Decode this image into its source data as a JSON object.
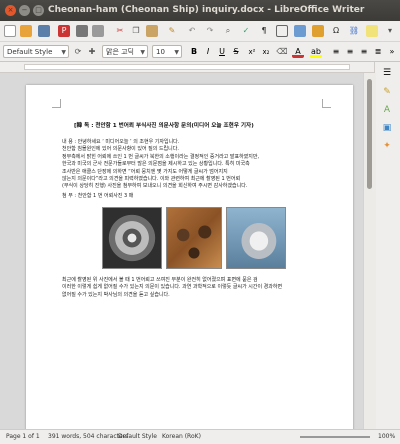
{
  "window": {
    "title": "Cheonan-ham (Cheonan Ship) inquiry.docx - LibreOffice Writer",
    "controls": {
      "close": "×",
      "minimize": "−",
      "maximize": "□"
    }
  },
  "toolbar": {
    "paragraph_style": "Default Style",
    "font_name": "맑은 고딕",
    "font_size": "10"
  },
  "document": {
    "heading": "[韓 독 : 천안함 1 번어뢰 부식사진 의문사항 문의(미디어 오늘 조현우 기자)",
    "body_lines": [
      "내 용 : 안녕하세요 ‘ 미디어오늘 ’ 의 조현우 기자입니다.",
      "천안함 침몰원인에 있어 의문사항이 있어 질의 드립니다.",
      "정부측에서 밝힌 어뢰에 쓰인 1 번 글씨가 북한의 소행이라는 결정적인 증거라고 발표하였지만,",
      "한국과 미국의 군사 전문가들로부터 많은 의문점을 제시하고 있는 상황입니다. 특히 미국측",
      "조사반은 애클스 단장에 의하면 “어뢰 뭉치엔 몇 가지도 어떻게 글씨가 엄어지지",
      "않는지 의문이다”라고 의견을 피력하였습니다. 이와 관련하여 최근에 촬영된 1 번어뢰",
      "(무식이 상당히 진행) 사진을 첨부하여 보내오니 의견을 회신하여 주시면 감사하겠습니다."
    ],
    "attachment_line": "첨 부 : 천안함 1 번 어뢰사진 3 매",
    "footer_lines": [
      "최근에 촬영된 위 사진에서 볼 때 1 번어뢰고 쓰여진 부분이 완전히 없어졌으며 표면에 묻은 검",
      "이러한 이렇게 쉽게 없어질 수가 있는지 의문이 있습니다. 과연 과학적으로 이렇듯 글씨가 시간이 경과하면",
      "없어질 수가 있는지 박사님의 의견을 듣고 싶습니다."
    ],
    "photos": [
      "torpedo-propeller-photo",
      "torpedo-rusted-gear-photo",
      "torpedo-motor-photo"
    ]
  },
  "status_bar": {
    "page": "Page 1 of 1",
    "word_count": "391 words, 504 characters",
    "page_style": "Default Style",
    "language": "Korean (RoK)",
    "zoom": "100%"
  },
  "colors": {
    "titlebar": "#3c3b37",
    "close_button": "#e2572c",
    "chrome": "#efeeec",
    "canvas": "#d9d9d9"
  }
}
